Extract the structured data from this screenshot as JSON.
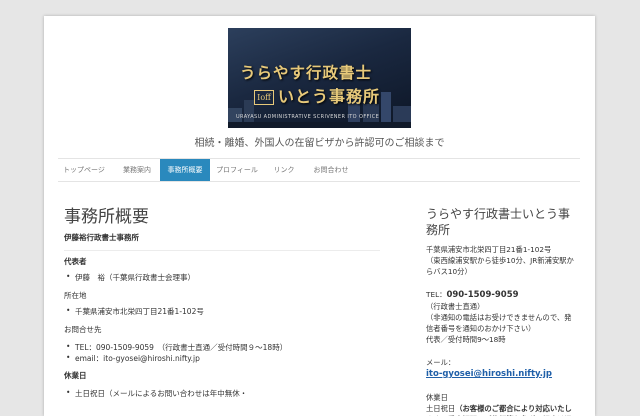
{
  "logo": {
    "line1": "うらやす行政書士",
    "badge": "Ioff",
    "line2": "いとう事務所",
    "sub": "URAYASU ADMINISTRATIVE SCRIVENER ITO OFFICE"
  },
  "tagline": "相続・離婚、外国人の在留ビザから許認可のご相談まで",
  "nav": {
    "items": [
      {
        "label": "トップページ"
      },
      {
        "label": "業務案内"
      },
      {
        "label": "事務所概要"
      },
      {
        "label": "プロフィール"
      },
      {
        "label": "リンク"
      },
      {
        "label": "お問合わせ"
      }
    ]
  },
  "main": {
    "title": "事務所概要",
    "office_name": "伊藤裕行政書士事務所",
    "rep_label": "代表者",
    "rep_value": "伊藤　裕（千葉県行政書士会理事）",
    "addr_label": "所在地",
    "addr_value": "千葉県浦安市北栄四丁目21番1-102号",
    "contact_label": "お問合せ先",
    "contact_tel": "TEL：090-1509-9059　（行政書士直通／受付時間９～18時）",
    "contact_email": "email：ito-gyosei@hiroshi.nifty.jp",
    "holiday_label": "休業日",
    "holiday_value": "土日祝日（メールによるお問い合わせは年中無休・"
  },
  "sidebar": {
    "title": "うらやす行政書士いとう事務所",
    "address": "千葉県浦安市北栄四丁目21番1-102号",
    "access": "（東西線浦安駅から徒歩10分、JR新浦安駅からバス10分）",
    "tel_prefix": "TEL：",
    "tel": "090-1509-9059",
    "tel_suffix": "（行政書士直通）",
    "tel_note": "（非通知の電話はお受けできませんので、発信者番号を通知のおかけ下さい）",
    "tel_hours": "代表／受付時間9～18時",
    "mail_label": "メール：",
    "mail": "ito-gyosei@hiroshi.nifty.jp",
    "holiday_label": "休業日",
    "holiday_prefix": "土日祝日",
    "holiday_text": "（お客様のご都合により対応いたします・重度証明のご依頼等お急ぎの場合は迅速な"
  }
}
